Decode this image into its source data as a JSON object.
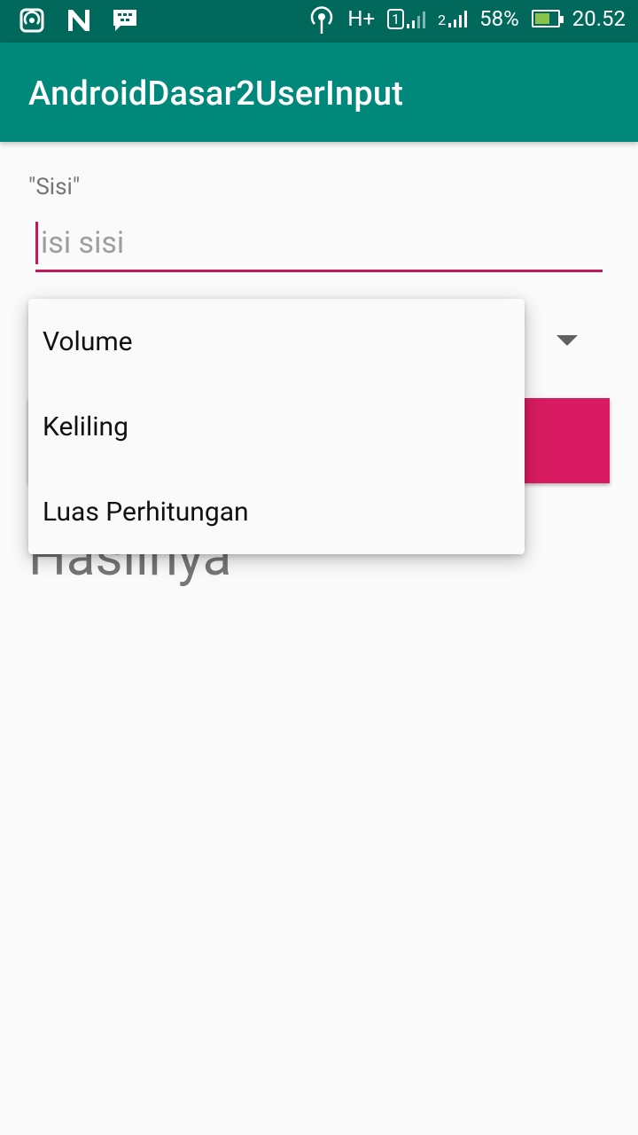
{
  "status_bar": {
    "battery_percent": "58%",
    "time": "20.52",
    "network_type": "H+",
    "sim1_label": "1",
    "sim2_label": "2",
    "icons": [
      "hotspot-icon",
      "n-icon",
      "bbm-icon",
      "wireless-icon",
      "signal-icon",
      "battery-icon"
    ]
  },
  "appbar": {
    "title": "AndroidDasar2UserInput"
  },
  "form": {
    "sisi_label": "\"Sisi\"",
    "sisi_placeholder": "isi sisi",
    "button_label": ""
  },
  "result": {
    "text": "Hasilnya"
  },
  "dropdown": {
    "items": [
      {
        "label": "Volume"
      },
      {
        "label": "Keliling"
      },
      {
        "label": "Luas Perhitungan"
      }
    ]
  },
  "colors": {
    "statusbar": "#00695c",
    "appbar": "#00897b",
    "accent": "#d81b60",
    "underline": "#c2185b"
  }
}
